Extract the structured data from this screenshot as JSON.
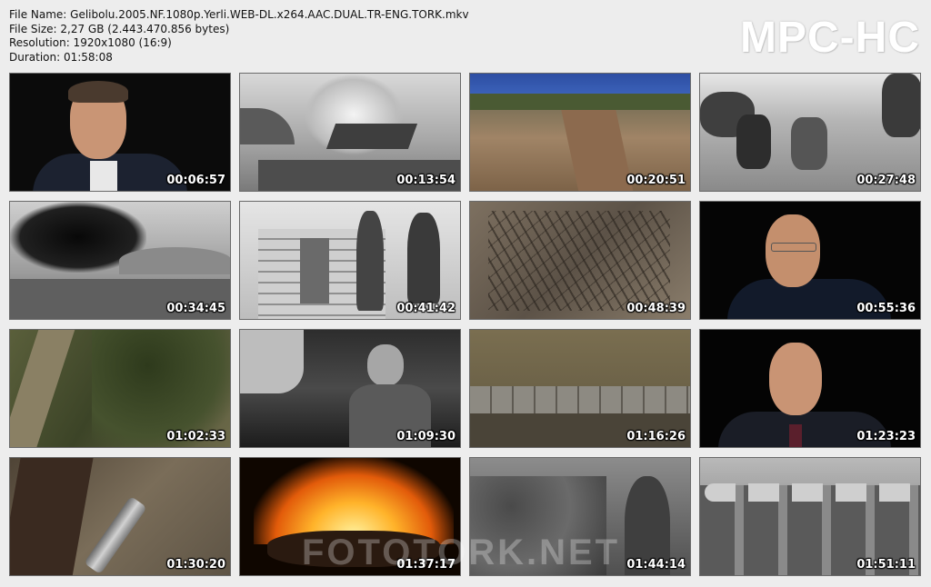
{
  "info": {
    "file_name": "File Name: Gelibolu.2005.NF.1080p.Yerli.WEB-DL.x264.AAC.DUAL.TR-ENG.TORK.mkv",
    "file_size": "File Size: 2,27 GB (2.443.470.856 bytes)",
    "resolution": "Resolution: 1920x1080 (16:9)",
    "duration": "Duration: 01:58:08"
  },
  "brand": "MPC-HC",
  "watermark": "FOTOTORK.NET",
  "thumbnails": [
    {
      "time": "00:06:57",
      "scene": "interview-man-dark-suit"
    },
    {
      "time": "00:13:54",
      "scene": "illustration-ship-explosion"
    },
    {
      "time": "00:20:51",
      "scene": "coastal-cliffs"
    },
    {
      "time": "00:27:48",
      "scene": "illustration-soldiers-in-water"
    },
    {
      "time": "00:34:45",
      "scene": "battlefield-black-smoke"
    },
    {
      "time": "00:41:42",
      "scene": "sikh-soldiers-sandbags"
    },
    {
      "time": "00:48:39",
      "scene": "dry-thorn-bushes"
    },
    {
      "time": "00:55:36",
      "scene": "interview-man-glasses"
    },
    {
      "time": "01:02:33",
      "scene": "hillside-path"
    },
    {
      "time": "01:09:30",
      "scene": "soldier-in-trench"
    },
    {
      "time": "01:16:26",
      "scene": "sandbag-trench-line"
    },
    {
      "time": "01:23:23",
      "scene": "interview-man-tie"
    },
    {
      "time": "01:30:20",
      "scene": "metal-whistle-on-ground"
    },
    {
      "time": "01:37:17",
      "scene": "burning-fire"
    },
    {
      "time": "01:44:14",
      "scene": "soldiers-in-trench-archive"
    },
    {
      "time": "01:51:11",
      "scene": "group-soldiers-pith-helmets"
    }
  ]
}
